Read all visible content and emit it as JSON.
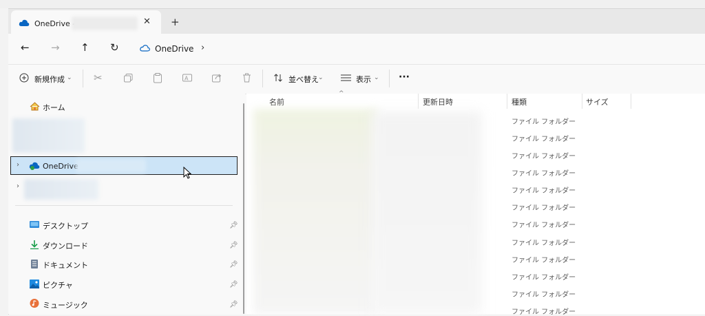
{
  "tab": {
    "title": "OneDrive -",
    "close": "✕",
    "new_tab": "+"
  },
  "nav": {
    "back": "←",
    "forward": "→",
    "up": "↑",
    "refresh": "↻"
  },
  "address": {
    "location": "OneDrive",
    "chevron": "›"
  },
  "commands": {
    "new": "新規作成",
    "sort": "並べ替え",
    "view": "表示",
    "more": "···"
  },
  "sidebar": {
    "home": "ホーム",
    "onedrive": "OneDrive -",
    "quick_access": [
      {
        "label": "デスクトップ",
        "icon": "desktop-icon"
      },
      {
        "label": "ダウンロード",
        "icon": "download-icon"
      },
      {
        "label": "ドキュメント",
        "icon": "document-icon"
      },
      {
        "label": "ピクチャ",
        "icon": "pictures-icon"
      },
      {
        "label": "ミュージック",
        "icon": "music-icon"
      }
    ]
  },
  "columns": {
    "name": "名前",
    "modified": "更新日時",
    "type": "種類",
    "size": "サイズ"
  },
  "rows": [
    {
      "type": "ファイル フォルダー"
    },
    {
      "type": "ファイル フォルダー"
    },
    {
      "type": "ファイル フォルダー"
    },
    {
      "type": "ファイル フォルダー"
    },
    {
      "type": "ファイル フォルダー"
    },
    {
      "type": "ファイル フォルダー"
    },
    {
      "type": "ファイル フォルダー"
    },
    {
      "type": "ファイル フォルダー"
    },
    {
      "type": "ファイル フォルダー"
    },
    {
      "type": "ファイル フォルダー"
    },
    {
      "type": "ファイル フォルダー"
    },
    {
      "type": "ファイル フォルダー"
    }
  ],
  "colors": {
    "accent": "#0f6cbd",
    "selection": "#cce4f7",
    "onedrive_blue": "#0364b8"
  }
}
